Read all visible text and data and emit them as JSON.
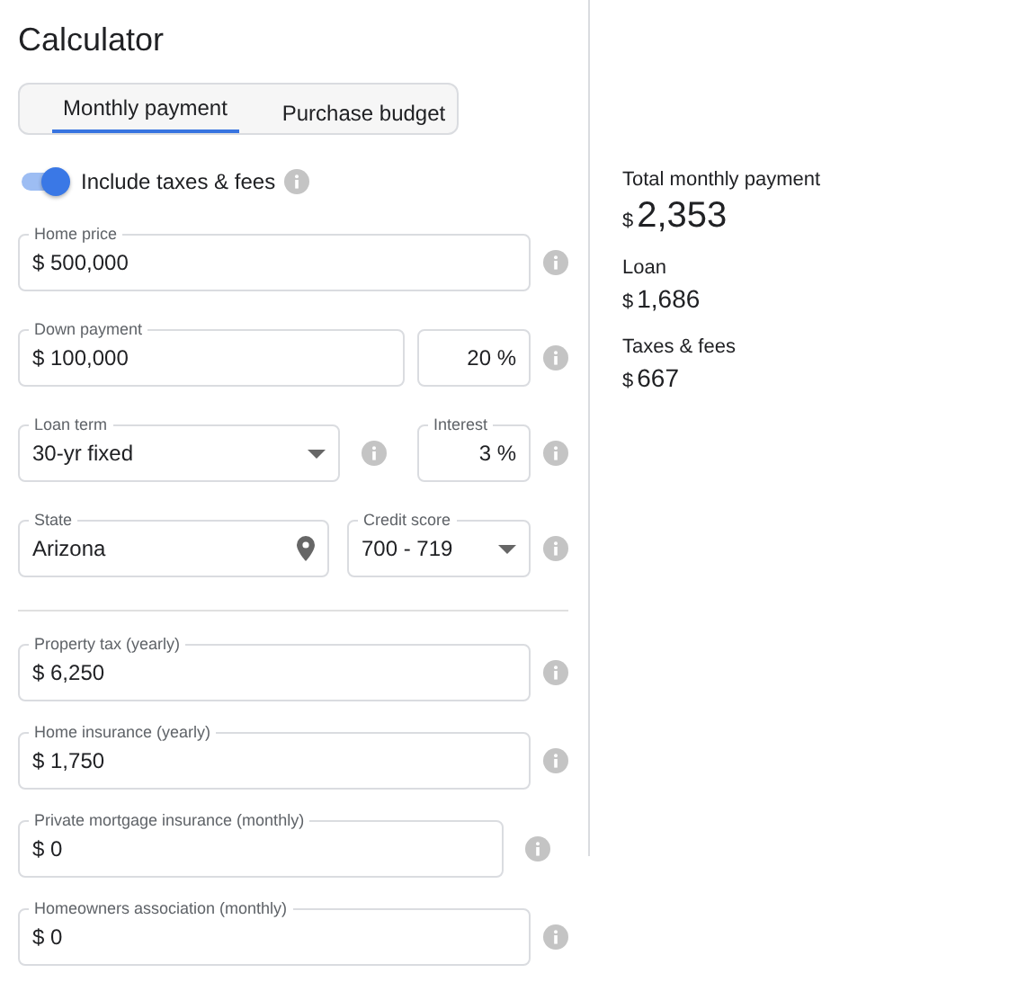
{
  "title": "Calculator",
  "tabs": [
    {
      "label": "Monthly payment",
      "selected": true
    },
    {
      "label": "Purchase budget",
      "selected": false
    }
  ],
  "toggle": {
    "label": "Include taxes & fees",
    "on": true
  },
  "sections": [
    {
      "rows": [
        {
          "items": [
            {
              "kind": "text",
              "label": "Home price",
              "value": "$ 500,000"
            },
            {
              "kind": "info"
            }
          ]
        },
        {
          "items": [
            {
              "kind": "text",
              "label": "Down payment",
              "value": "$ 100,000"
            },
            {
              "kind": "number",
              "value": "20 %"
            },
            {
              "kind": "info"
            }
          ]
        },
        {
          "items": [
            {
              "kind": "select",
              "label": "Loan term",
              "value": "30-yr fixed"
            },
            {
              "kind": "info"
            },
            {
              "kind": "number",
              "label": "Interest",
              "value": "3 %"
            },
            {
              "kind": "info"
            }
          ]
        },
        {
          "items": [
            {
              "kind": "place",
              "label": "State",
              "value": "Arizona"
            },
            {
              "kind": "select",
              "label": "Credit score",
              "value": "700 - 719"
            },
            {
              "kind": "info"
            }
          ]
        }
      ]
    },
    {
      "rows": [
        {
          "items": [
            {
              "kind": "text",
              "label": "Property tax (yearly)",
              "value": "$ 6,250"
            },
            {
              "kind": "info"
            }
          ]
        },
        {
          "items": [
            {
              "kind": "text",
              "label": "Home insurance (yearly)",
              "value": "$ 1,750"
            },
            {
              "kind": "info"
            }
          ]
        },
        {
          "items": [
            {
              "kind": "text",
              "label": "Private mortgage insurance (monthly)",
              "value": "$ 0"
            },
            {
              "kind": "info"
            }
          ]
        },
        {
          "items": [
            {
              "kind": "text",
              "label": "Homeowners association (monthly)",
              "value": "$ 0"
            },
            {
              "kind": "info"
            }
          ]
        }
      ]
    }
  ],
  "summary": [
    {
      "label": "Total monthly payment",
      "currency": "$",
      "amount": "2,353",
      "kind": "total"
    },
    {
      "label": "Loan",
      "currency": "$",
      "amount": "1,686",
      "kind": "part"
    },
    {
      "label": "Taxes & fees",
      "currency": "$",
      "amount": "667",
      "kind": "part"
    }
  ]
}
